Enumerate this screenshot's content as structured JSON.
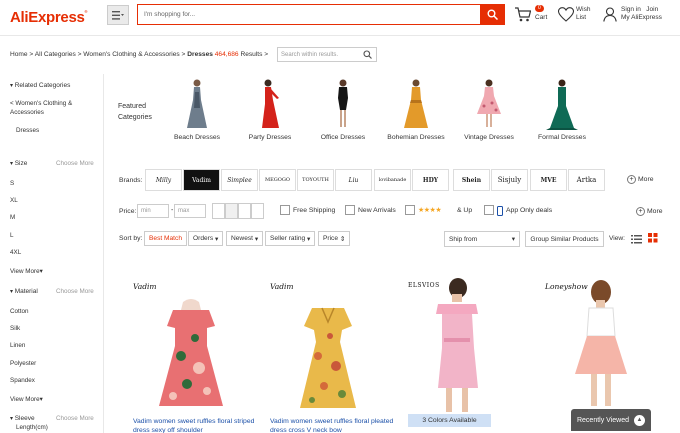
{
  "header": {
    "logo": "AliExpress",
    "search_placeholder": "I'm shopping for...",
    "cart_count": "0",
    "cart_label": "Cart",
    "wish_label_1": "Wish",
    "wish_label_2": "List",
    "signin": "Sign in",
    "join": "Join",
    "my_account": "My AliExpress"
  },
  "breadcrumb": {
    "text": "Home > All Categories > Women's Clothing & Accessories > ",
    "current": "Dresses",
    "count": "464,686",
    "results": "Results >",
    "search_within": "Search within results."
  },
  "sidebar": {
    "related_title": "Related Categories",
    "parent_1": "< Women's Clothing &",
    "parent_2": "Accessories",
    "current": "Dresses",
    "size_title": "Size",
    "choose_more": "Choose More",
    "sizes": [
      "S",
      "XL",
      "M",
      "L",
      "4XL"
    ],
    "view_more": "View More",
    "material_title": "Material",
    "materials": [
      "Cotton",
      "Silk",
      "Linen",
      "Polyester",
      "Spandex"
    ],
    "sleeve_title": "Sleeve",
    "sleeve_sub": "Length(cm)"
  },
  "featured": {
    "label_1": "Featured",
    "label_2": "Categories",
    "items": [
      "Beach Dresses",
      "Party Dresses",
      "Office Dresses",
      "Bohemian Dresses",
      "Vintage Dresses",
      "Formal Dresses"
    ]
  },
  "brands": {
    "label": "Brands:",
    "items": [
      "Milly",
      "Vadim",
      "Simplee",
      "MEGOGO",
      "TOYOUTH",
      "Liu",
      "lovibanade",
      "HDY",
      "Shein",
      "Sisjuly",
      "MVE",
      "Artka"
    ],
    "more": "More"
  },
  "filters": {
    "price_label": "Price:",
    "min": "min",
    "max": "max",
    "free_shipping": "Free Shipping",
    "new_arrivals": "New Arrivals",
    "stars": "★★★★",
    "and_up": "& Up",
    "app_only": "App Only deals",
    "more": "More"
  },
  "sort": {
    "label": "Sort by:",
    "best_match": "Best Match",
    "orders": "Orders",
    "newest": "Newest",
    "seller_rating": "Seller rating",
    "price": "Price",
    "ship_from": "Ship from",
    "group": "Group Similar Products",
    "view": "View:"
  },
  "products": [
    {
      "brand": "Vadim",
      "title": "Vadim women sweet ruffles floral striped dress sexy off shoulder"
    },
    {
      "brand": "Vadim",
      "title": "Vadim women sweet ruffles floral pleated dress cross V neck bow"
    },
    {
      "brand": "ELSVIOS",
      "title": "",
      "banner": "3 Colors Available"
    },
    {
      "brand": "Loneyshow",
      "title": ""
    }
  ],
  "recently_viewed": "Recently Viewed",
  "colors": {
    "accent": "#e62e04",
    "link": "#1a4fa8",
    "star": "#f5a623"
  }
}
